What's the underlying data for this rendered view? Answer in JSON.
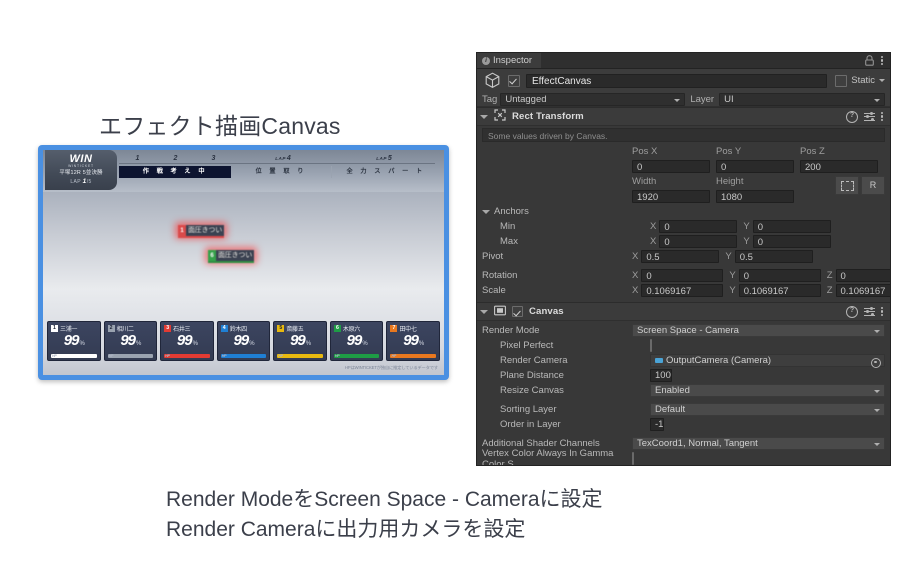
{
  "captions": {
    "top": "エフェクト描画Canvas",
    "bottom_line1": "Render ModeをScreen Space - Cameraに設定",
    "bottom_line2": "Render Cameraに出力用カメラを設定"
  },
  "game_panel": {
    "win_logo": "WIN",
    "win_sub": "WINTICKET",
    "race_title": "平塚12R 5並決勝",
    "lap_prefix": "LAP",
    "lap_current": "1",
    "lap_total": "/5",
    "lap_markers": [
      {
        "label": "1",
        "prefix": ""
      },
      {
        "label": "2",
        "prefix": ""
      },
      {
        "label": "3",
        "prefix": ""
      },
      {
        "label": "4",
        "prefix": "LAP"
      },
      {
        "label": "5",
        "prefix": "LAP"
      }
    ],
    "phases": [
      {
        "text": "作 戦 考 え 中",
        "active": true
      },
      {
        "text": "位 置 取 り",
        "active": false
      },
      {
        "text": "全 力 ス パ ー ト",
        "active": false
      }
    ],
    "float_labels": [
      {
        "no": "1",
        "text": "面圧きつい",
        "color": "#d94a4a",
        "bar": "#d94a4a"
      },
      {
        "no": "6",
        "text": "面圧きつい",
        "color": "#35a14a",
        "bar": "#2f8f42"
      }
    ],
    "hp_label": "HP",
    "percent_symbol": "%",
    "footer_note": "HPはWINTICKETが独自に推定しているデータです",
    "players": [
      {
        "no": "1",
        "name": "三浦一",
        "hp": "99",
        "color": "#ffffff",
        "no_bg": "#ffffff",
        "no_fg": "#1b2032",
        "bar": "#ffffff"
      },
      {
        "no": "2",
        "name": "相川二",
        "hp": "99",
        "color": "#9aa3b0",
        "no_bg": "#9aa3b0",
        "no_fg": "#1b2032",
        "bar": "#9aa3b0"
      },
      {
        "no": "3",
        "name": "石井三",
        "hp": "99",
        "color": "#e23b33",
        "no_bg": "#e23b33",
        "no_fg": "#ffffff",
        "bar": "#e23b33"
      },
      {
        "no": "4",
        "name": "鈴木四",
        "hp": "99",
        "color": "#1f7fd4",
        "no_bg": "#1f7fd4",
        "no_fg": "#ffffff",
        "bar": "#1f7fd4"
      },
      {
        "no": "5",
        "name": "斎藤五",
        "hp": "99",
        "color": "#e8b90f",
        "no_bg": "#e8b90f",
        "no_fg": "#1b2032",
        "bar": "#e8b90f"
      },
      {
        "no": "6",
        "name": "木原六",
        "hp": "99",
        "color": "#1e9c45",
        "no_bg": "#1e9c45",
        "no_fg": "#ffffff",
        "bar": "#1e9c45"
      },
      {
        "no": "7",
        "name": "田中七",
        "hp": "99",
        "color": "#e8781f",
        "no_bg": "#e8781f",
        "no_fg": "#ffffff",
        "bar": "#e8781f"
      }
    ]
  },
  "inspector": {
    "tab_label": "Inspector",
    "object": {
      "name": "EffectCanvas",
      "enabled": true,
      "static_label": "Static",
      "static_checked": false,
      "tag_label": "Tag",
      "tag_value": "Untagged",
      "layer_label": "Layer",
      "layer_value": "UI"
    },
    "rect_transform": {
      "title": "Rect Transform",
      "note": "Some values driven by Canvas.",
      "pos_headers": [
        "Pos X",
        "Pos Y",
        "Pos Z"
      ],
      "pos_values": [
        "0",
        "0",
        "200"
      ],
      "size_headers": [
        "Width",
        "Height"
      ],
      "size_values": [
        "1920",
        "1080"
      ],
      "anchors_label": "Anchors",
      "min_label": "Min",
      "min_x": "0",
      "min_y": "0",
      "max_label": "Max",
      "max_x": "0",
      "max_y": "0",
      "pivot_label": "Pivot",
      "pivot_x": "0.5",
      "pivot_y": "0.5",
      "rotation_label": "Rotation",
      "rotation": [
        "0",
        "0",
        "0"
      ],
      "scale_label": "Scale",
      "scale": [
        "0.1069167",
        "0.1069167",
        "0.1069167"
      ],
      "axis_x": "X",
      "axis_y": "Y",
      "axis_z": "Z",
      "blueprint_label": "R"
    },
    "canvas": {
      "title": "Canvas",
      "enabled": true,
      "rows": [
        {
          "label": "Render Mode",
          "value": "Screen Space - Camera",
          "type": "dropdown",
          "indent": false
        },
        {
          "label": "Pixel Perfect",
          "value": "",
          "type": "checkbox",
          "indent": true
        },
        {
          "label": "Render Camera",
          "value": "OutputCamera (Camera)",
          "type": "object",
          "indent": true
        },
        {
          "label": "Plane Distance",
          "value": "100",
          "type": "input",
          "indent": true
        },
        {
          "label": "Resize Canvas",
          "value": "Enabled",
          "type": "dropdown",
          "indent": true
        },
        {
          "label": "Sorting Layer",
          "value": "Default",
          "type": "dropdown",
          "indent": true
        },
        {
          "label": "Order in Layer",
          "value": "-1",
          "type": "input",
          "indent": true
        },
        {
          "label": "Additional Shader Channels",
          "value": "TexCoord1, Normal, Tangent",
          "type": "dropdown",
          "indent": false
        },
        {
          "label": "Vertex Color Always In Gamma Color S",
          "value": "",
          "type": "checkbox",
          "indent": false
        }
      ]
    }
  }
}
